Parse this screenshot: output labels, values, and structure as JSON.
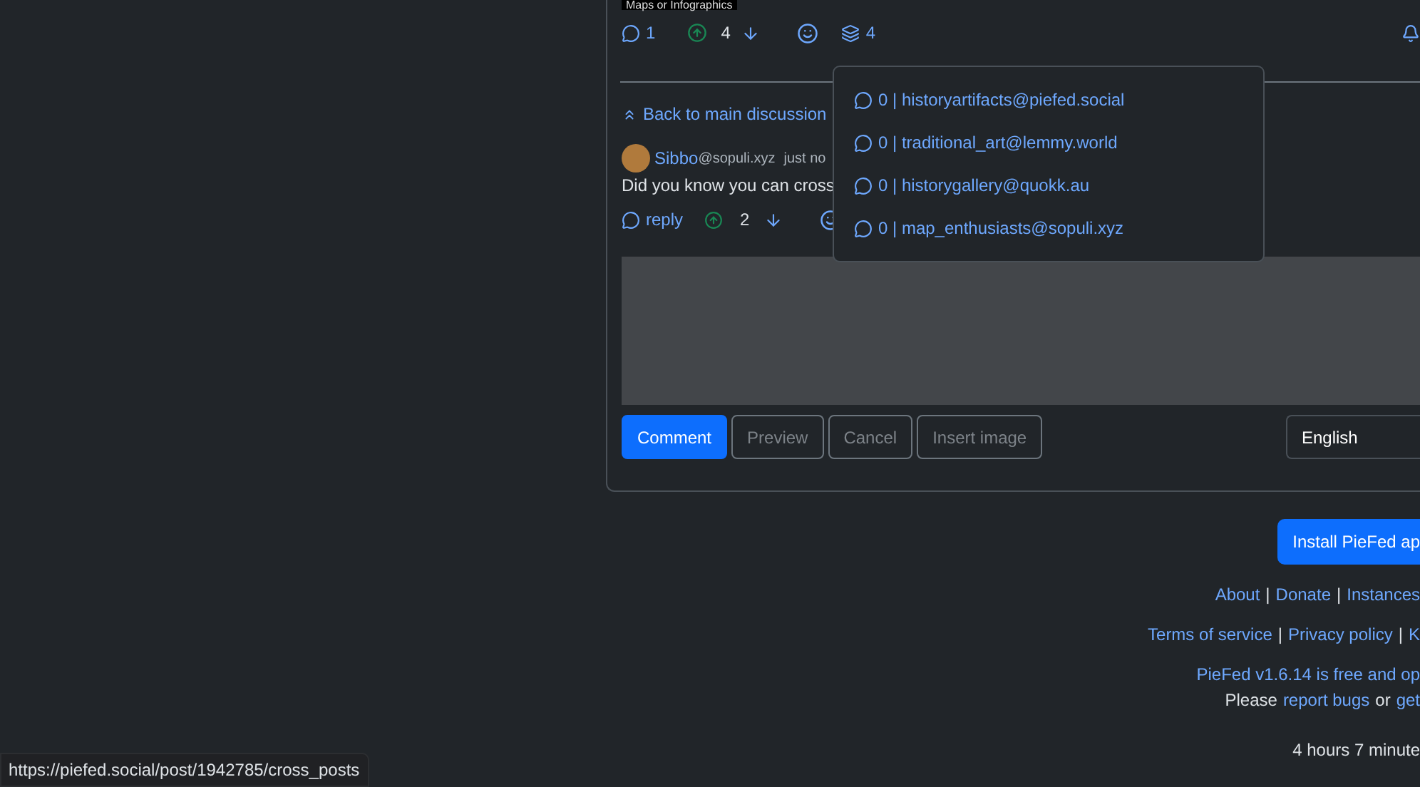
{
  "post": {
    "tag": "Maps or Infographics",
    "actions": {
      "comments": "1",
      "score": "4",
      "upvoted": true,
      "cross_posts": "4"
    }
  },
  "cross_post_menu": {
    "items": [
      {
        "label": "0 | historyartifacts@piefed.social"
      },
      {
        "label": "0 | traditional_art@lemmy.world"
      },
      {
        "label": "0 | historygallery@quokk.au"
      },
      {
        "label": "0 | map_enthusiasts@sopuli.xyz"
      }
    ]
  },
  "back_link": "Back to main discussion",
  "comment": {
    "author": "Sibbo",
    "instance": "@sopuli.xyz",
    "time": "just no",
    "body": "Did you know you can cross",
    "reply": "reply",
    "score": "2",
    "upvoted": true
  },
  "editor": {
    "buttons": [
      {
        "label": "Comment",
        "kind": "primary"
      },
      {
        "label": "Preview",
        "kind": "outline"
      },
      {
        "label": "Cancel",
        "kind": "outline"
      },
      {
        "label": "Insert image",
        "kind": "outline"
      }
    ],
    "language": "English"
  },
  "footer": {
    "install_button": "Install PieFed ap",
    "links_1": [
      "About",
      "Donate",
      "Instances"
    ],
    "links_1_separators": [
      "|",
      "|"
    ],
    "links_2": [
      "Terms of service",
      "Privacy policy",
      "K"
    ],
    "links_2_separators": [
      "|",
      "|"
    ],
    "version_text": "PieFed v1.6.14 is free and op",
    "please": "Please",
    "report_bugs": "report bugs",
    "or": "or",
    "get": "get",
    "time": "4 hours 7 minute"
  },
  "status_url": "https://piefed.social/post/1942785/cross_posts"
}
